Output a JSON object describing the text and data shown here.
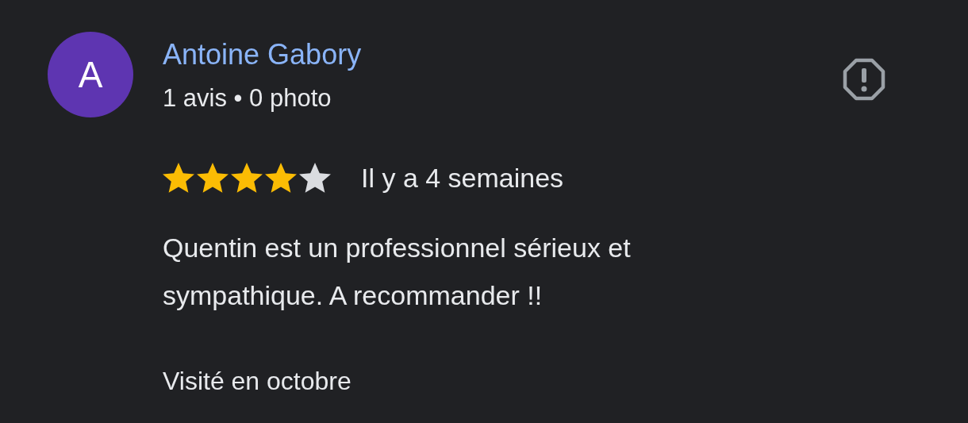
{
  "reviewer": {
    "initial": "A",
    "name": "Antoine Gabory",
    "subtitle": "1 avis • 0 photo"
  },
  "review": {
    "stars": 4,
    "time": "Il y a 4 semaines",
    "text": "Quentin est un professionnel sérieux et sympathique. A recommander !!",
    "visited": "Visité en octobre"
  }
}
